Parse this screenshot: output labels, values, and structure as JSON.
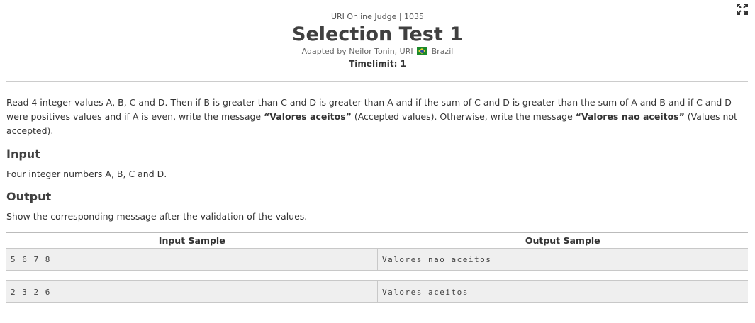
{
  "header": {
    "judge": "URI Online Judge | 1035",
    "title": "Selection Test 1",
    "author_prefix": "Adapted by Neilor Tonin, URI",
    "country": "Brazil",
    "timelimit": "Timelimit: 1"
  },
  "icons": {
    "expand": "expand-icon",
    "flag": "brazil-flag-icon"
  },
  "description": {
    "part1": "Read 4 integer values A, B, C and D. Then if B is greater than C and D is greater than A and if the sum of C and D is greater than the sum of A and B and if C and D were positives values and if A is even, write the message ",
    "msg_accepted": "“Valores aceitos”",
    "part2": " (Accepted values). Otherwise, write the message ",
    "msg_not_accepted": "“Valores nao aceitos”",
    "part3": " (Values not accepted)."
  },
  "input": {
    "heading": "Input",
    "text": "Four integer numbers A, B, C and D."
  },
  "output": {
    "heading": "Output",
    "text": "Show the corresponding message after the validation of the values."
  },
  "samples": {
    "input_header": "Input Sample",
    "output_header": "Output Sample",
    "rows": [
      {
        "input": "5 6 7 8",
        "output": "Valores nao aceitos"
      },
      {
        "input": "2 3 2 6",
        "output": "Valores aceitos"
      }
    ]
  }
}
